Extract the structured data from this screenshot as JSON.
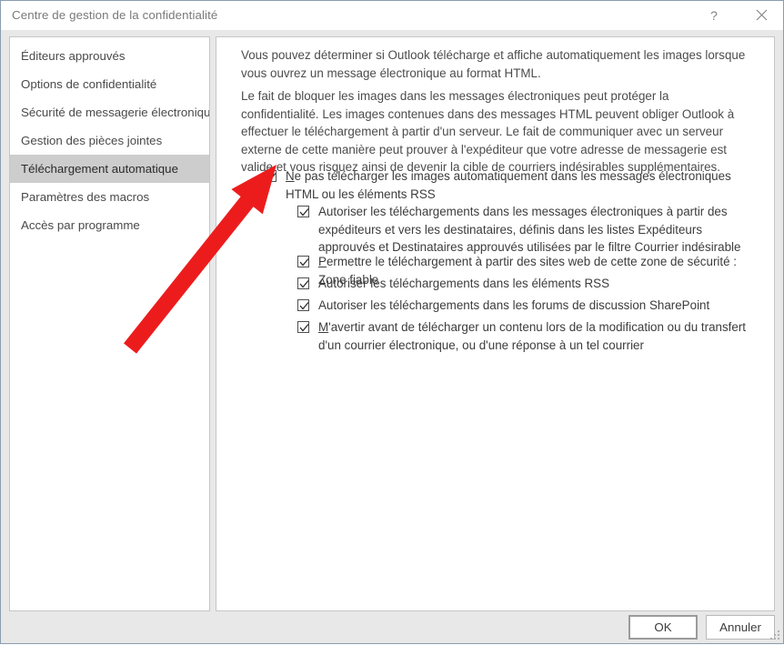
{
  "window": {
    "title": "Centre de gestion de la confidentialité",
    "help_glyph": "?",
    "close_glyph": "✕"
  },
  "sidebar": {
    "items": [
      {
        "label": "Éditeurs approuvés",
        "selected": false
      },
      {
        "label": "Options de confidentialité",
        "selected": false
      },
      {
        "label": "Sécurité de messagerie électronique",
        "selected": false
      },
      {
        "label": "Gestion des pièces jointes",
        "selected": false
      },
      {
        "label": "Téléchargement automatique",
        "selected": true
      },
      {
        "label": "Paramètres des macros",
        "selected": false
      },
      {
        "label": "Accès par programme",
        "selected": false
      }
    ]
  },
  "main": {
    "paragraph_1": "Vous pouvez déterminer si Outlook télécharge et affiche automatiquement les images lorsque vous ouvrez un message électronique au format HTML.",
    "paragraph_2": "Le fait de bloquer les images dans les messages électroniques peut protéger la confidentialité. Les images contenues dans des messages HTML peuvent obliger Outlook à effectuer le téléchargement à partir d'un serveur. Le fait de communiquer avec un serveur externe de cette manière peut prouver à l'expéditeur que votre adresse de messagerie est valide et vous risquez ainsi de devenir la cible de courriers indésirables supplémentaires.",
    "checkboxes": [
      {
        "id": "no-auto-download",
        "accel": "N",
        "rest": "e pas télécharger les images automatiquement dans les messages électroniques HTML ou les éléments RSS",
        "checked": true
      },
      {
        "id": "allow-from-approved-senders",
        "accel": "",
        "rest": "Autoriser les téléchargements dans les messages électroniques à partir des expéditeurs et vers les destinataires, définis dans les listes Expéditeurs approuvés et Destinataires approuvés utilisées par le filtre Courrier indésirable",
        "checked": true
      },
      {
        "id": "allow-trusted-zone-sites",
        "accel": "P",
        "rest": "ermettre le téléchargement à partir des sites web de cette zone de sécurité : Zone fiable",
        "checked": true
      },
      {
        "id": "allow-rss-items",
        "accel": "",
        "rest": "Autoriser les téléchargements dans les éléments RSS",
        "checked": true
      },
      {
        "id": "allow-sharepoint-discussions",
        "accel": "",
        "rest": "Autoriser les téléchargements dans les forums de discussion SharePoint",
        "checked": true
      },
      {
        "id": "warn-before-download",
        "accel": "M",
        "rest": "'avertir avant de télécharger un contenu lors de la modification ou du transfert d'un courrier électronique, ou d'une réponse à un tel courrier",
        "checked": true
      }
    ]
  },
  "footer": {
    "ok_label": "OK",
    "cancel_label": "Annuler"
  },
  "annotation": {
    "arrow_color": "#ed1c1c"
  }
}
